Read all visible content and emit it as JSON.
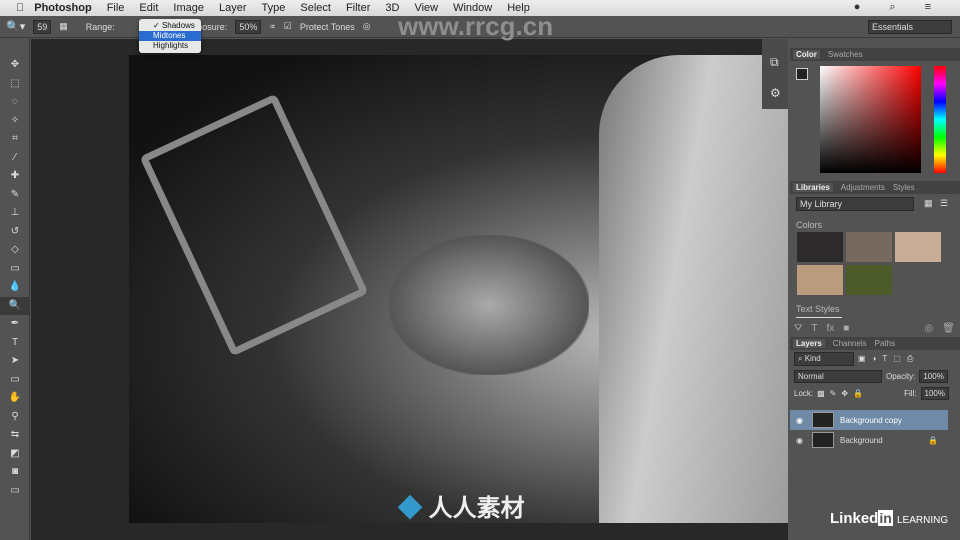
{
  "menubar": {
    "app": "Photoshop",
    "items": [
      "File",
      "Edit",
      "Image",
      "Layer",
      "Type",
      "Select",
      "Filter",
      "3D",
      "View",
      "Window",
      "Help"
    ]
  },
  "options": {
    "brush_size": "59",
    "range_label": "Range:",
    "range_options": [
      "Shadows",
      "Midtones",
      "Highlights"
    ],
    "range_selected": "Midtones",
    "exposure_label": "Exposure:",
    "exposure_value": "50%",
    "protect_tones": "Protect Tones",
    "protect_checked": true,
    "workspace": "Essentials"
  },
  "watermark": "www.rrcg.cn",
  "watermark2": "人人素材",
  "color_panel": {
    "tabs": [
      "Color",
      "Swatches"
    ]
  },
  "libraries": {
    "tabs": [
      "Libraries",
      "Adjustments",
      "Styles"
    ],
    "library": "My Library",
    "colors_label": "Colors",
    "colors": [
      "#2c2a2b",
      "#766960",
      "#c9ad96",
      "#ba9b7e",
      "#4d5a2a"
    ],
    "text_styles_label": "Text Styles"
  },
  "layers": {
    "tabs": [
      "Layers",
      "Channels",
      "Paths"
    ],
    "filter": "Kind",
    "blend_mode": "Normal",
    "opacity_label": "Opacity:",
    "opacity": "100%",
    "lock_label": "Lock:",
    "fill_label": "Fill:",
    "fill": "100%",
    "items": [
      {
        "name": "Background copy",
        "selected": true
      },
      {
        "name": "Background",
        "locked": true
      }
    ]
  },
  "brand": {
    "name": "Linked",
    "in": "in",
    "suffix": "LEARNING"
  }
}
